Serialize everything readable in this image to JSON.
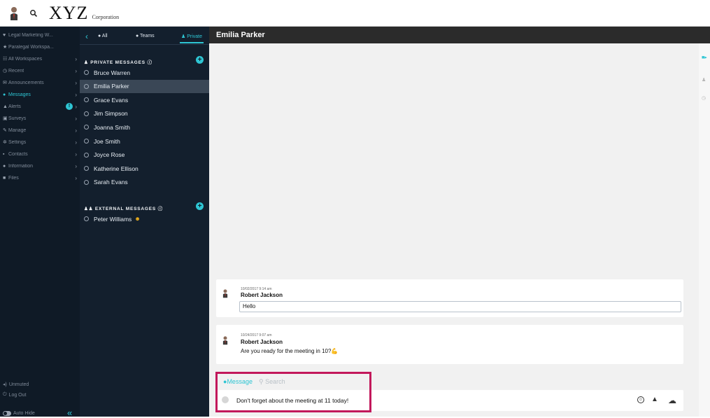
{
  "topbar": {
    "logo_main": "XYZ",
    "logo_sub": "Corporation"
  },
  "sidebar": {
    "items": [
      {
        "icon": "heart-icon",
        "glyph": "♥",
        "label": "Legal Marketing W...",
        "chevron": false
      },
      {
        "icon": "star-icon",
        "glyph": "★",
        "label": "Paralegal Workspa...",
        "chevron": false
      },
      {
        "icon": "grid-icon",
        "glyph": "☷",
        "label": "All Workspaces",
        "chevron": true
      },
      {
        "icon": "clock-icon",
        "glyph": "◷",
        "label": "Recent",
        "chevron": true
      },
      {
        "icon": "megaphone-icon",
        "glyph": "✉",
        "label": "Announcements",
        "chevron": true
      },
      {
        "icon": "chat-icon",
        "glyph": "●",
        "label": "Messages",
        "chevron": true,
        "active": true
      },
      {
        "icon": "alert-icon",
        "glyph": "▲",
        "label": "Alerts",
        "chevron": true,
        "badge": "!"
      },
      {
        "icon": "survey-icon",
        "glyph": "▣",
        "label": "Surveys",
        "chevron": true
      },
      {
        "icon": "wrench-icon",
        "glyph": "✎",
        "label": "Manage",
        "chevron": true
      },
      {
        "icon": "gear-icon",
        "glyph": "✲",
        "label": "Settings",
        "chevron": true
      },
      {
        "icon": "contacts-icon",
        "glyph": "▪",
        "label": "Contacts",
        "chevron": true
      },
      {
        "icon": "info-icon",
        "glyph": "●",
        "label": "Information",
        "chevron": true
      },
      {
        "icon": "folder-icon",
        "glyph": "■",
        "label": "Files",
        "chevron": true
      }
    ],
    "unmuted": "Unmuted",
    "logout": "Log Out",
    "autohide": "Auto Hide",
    "collapse_glyph": "«"
  },
  "msgpanel": {
    "tabs": {
      "all": "All",
      "teams": "Teams",
      "private": "Private"
    },
    "private_header": "PRIVATE MESSAGES",
    "private_contacts": [
      "Bruce Warren",
      "Emilia Parker",
      "Grace Evans",
      "Jim Simpson",
      "Joanna Smith",
      "Joe Smith",
      "Joyce Rose",
      "Katherine Ellison",
      "Sarah Evans"
    ],
    "selected_contact": "Emilia Parker",
    "external_header": "EXTERNAL MESSAGES",
    "external_contacts": [
      "Peter Williams"
    ]
  },
  "main": {
    "header_title": "Emilia Parker",
    "messages": [
      {
        "timestamp": "10/02/2017 9:14 am",
        "author": "Robert Jackson",
        "text": "Hello"
      },
      {
        "timestamp": "10/24/2017 9:07 am",
        "author": "Robert Jackson",
        "text": "Are you ready for the meeting in 10?💪"
      }
    ],
    "composer": {
      "tab_message": "Message",
      "tab_search": "Search",
      "text": "Don't forget about the meeting at 11 today!"
    }
  },
  "colors": {
    "accent": "#2ec5d3",
    "highlight": "#c2185b",
    "sidebar_bg": "#0f1a26",
    "header_bg": "#2b2b2b"
  }
}
